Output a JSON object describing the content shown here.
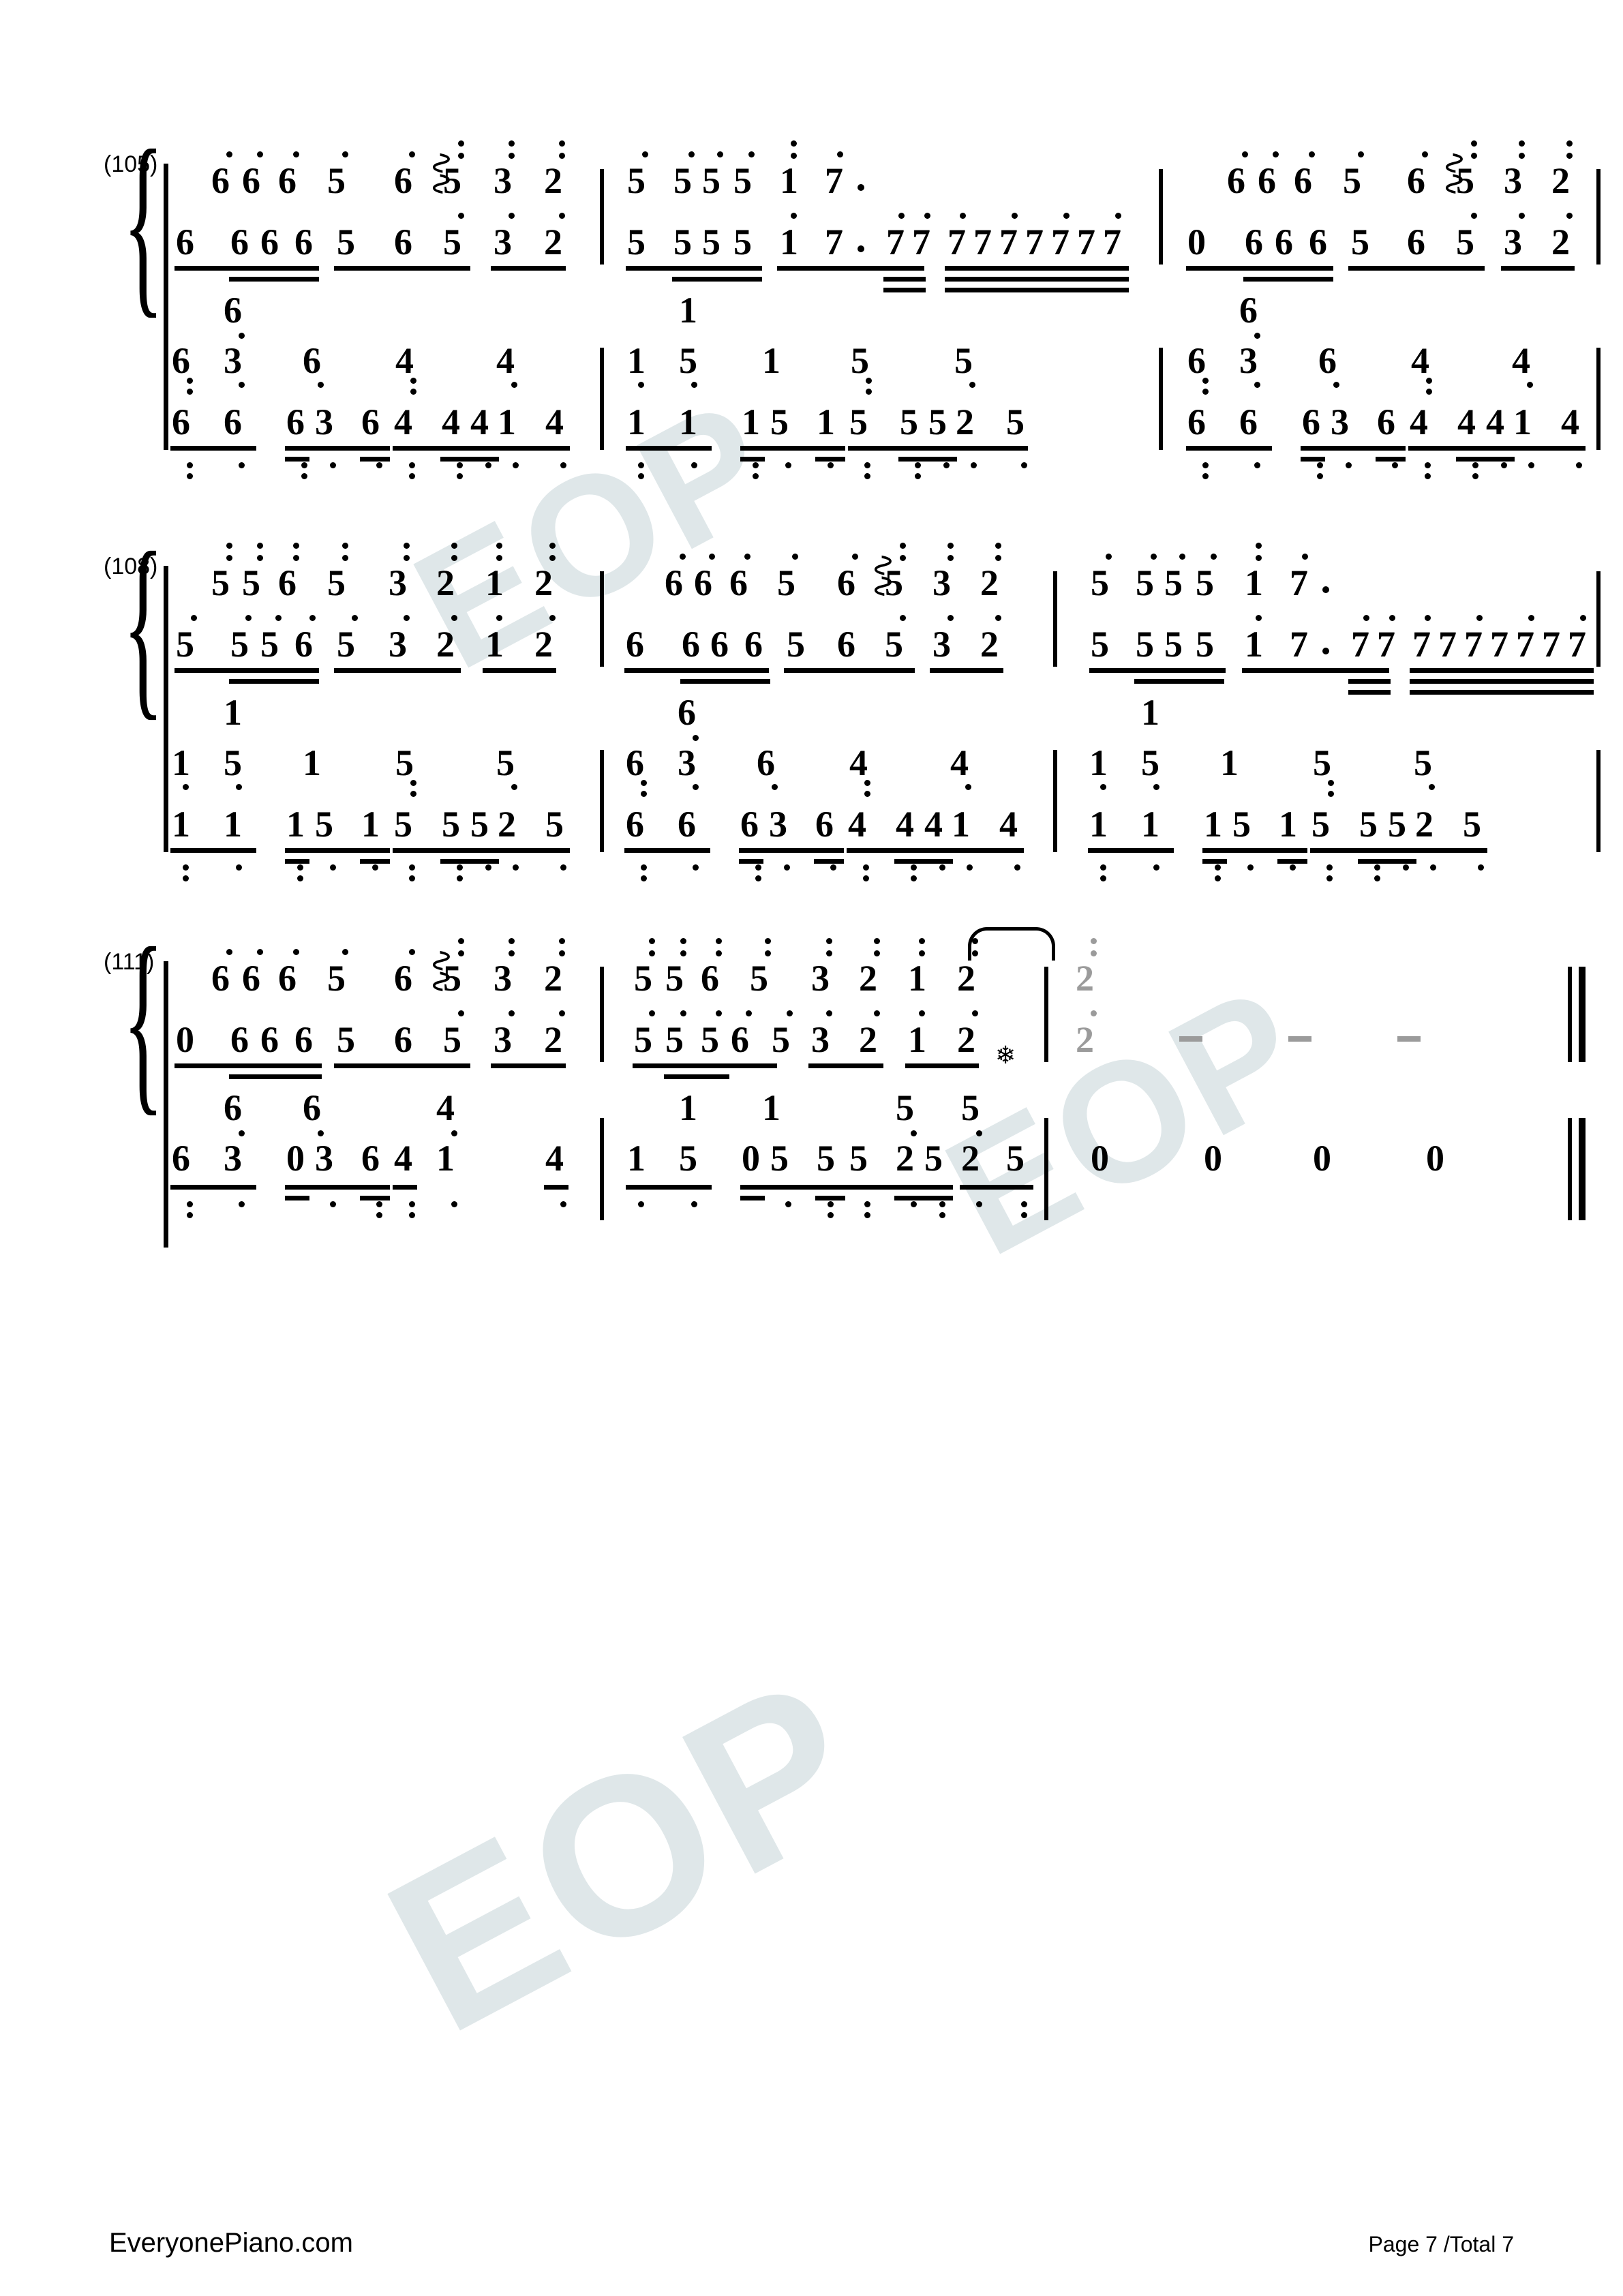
{
  "page": {
    "site": "EveryonePiano.com",
    "page_label": "Page 7 /Total 7",
    "watermark": "EOP",
    "watermark_color": "#dfe7e9",
    "ink_color": "#000000",
    "tie_color": "#9b9b9b",
    "notation_type": "jianpu-numbered-notation",
    "clefs": [
      "treble-right-hand",
      "bass-left-hand"
    ]
  },
  "systems": [
    {
      "measure_label": "(105)",
      "treble": {
        "measures": [
          {
            "cells": [
              {
                "t": "6",
                "up": 1,
                "beam": 1
              },
              {
                "t": "6",
                "up": 1,
                "beam": 2
              },
              {
                "t": "6",
                "up": 1,
                "beam": 1
              },
              {
                "t": "5",
                "up": 1,
                "beam": 1
              },
              {
                "t": "6",
                "up": 1,
                "beam": 1
              },
              {
                "t": "5",
                "up": 2,
                "beam": 1,
                "arp": true
              },
              {
                "t": "3",
                "up": 2,
                "beam": 1
              },
              {
                "t": "2",
                "up": 2,
                "beam": 1
              }
            ]
          },
          {
            "cells": [
              {
                "t": "5",
                "up": 1,
                "beam": 1
              },
              {
                "t": "5",
                "up": 1,
                "beam": 2
              },
              {
                "t": "5",
                "up": 1,
                "beam": 2
              },
              {
                "t": "5",
                "up": 1,
                "beam": 1
              },
              {
                "t": "1",
                "up": 2,
                "beam": 1
              },
              {
                "t": "7",
                "up": 1,
                "dot": true
              },
              {
                "t": "7",
                "up": 1,
                "beam": 2
              },
              {
                "t": "7",
                "up": 1,
                "beam": 2
              },
              {
                "t": "7",
                "up": 1,
                "beam": 3
              },
              {
                "t": "7",
                "up": 1,
                "beam": 3
              },
              {
                "t": "7",
                "up": 1,
                "beam": 3
              },
              {
                "t": "7",
                "up": 1,
                "beam": 3
              },
              {
                "t": "7",
                "up": 1,
                "beam": 3
              },
              {
                "t": "7",
                "up": 1,
                "beam": 3
              },
              {
                "t": "7",
                "up": 1,
                "beam": 3
              }
            ]
          },
          {
            "cells": [
              {
                "t": "0",
                "beam": 1
              },
              {
                "t": "6",
                "up": 1,
                "beam": 2
              },
              {
                "t": "6",
                "up": 1,
                "beam": 2
              },
              {
                "t": "6",
                "up": 1,
                "beam": 1
              },
              {
                "t": "5",
                "up": 1,
                "beam": 1
              },
              {
                "t": "6",
                "up": 1,
                "beam": 1
              },
              {
                "t": "5",
                "up": 2,
                "beam": 1,
                "arp": true
              },
              {
                "t": "3",
                "up": 2,
                "beam": 1
              },
              {
                "t": "2",
                "up": 2,
                "beam": 1
              }
            ]
          }
        ]
      },
      "bass": {
        "measures": [
          {
            "cells": [
              {
                "t": "6",
                "dn": 2,
                "top": "6",
                "topdn": 1
              },
              {
                "t": "6",
                "dn": 1,
                "beam": 1
              },
              {
                "t": "6",
                "dn": 1
              },
              {
                "t": "3",
                "beam": 1
              },
              {
                "t": "6",
                "dn": 1
              },
              {
                "t": "4",
                "dn": 2
              },
              {
                "t": "4",
                "beam": 1
              },
              {
                "t": "4",
                "beam": 1
              },
              {
                "t": "1",
                "dn": 1
              },
              {
                "t": "4",
                "beam": 1
              }
            ]
          },
          {
            "cells": [
              {
                "t": "1",
                "dn": 1,
                "top": "1"
              },
              {
                "t": "1",
                "dn": 1,
                "beam": 1
              },
              {
                "t": "1",
                "dn": 1
              },
              {
                "t": "5",
                "beam": 1
              },
              {
                "t": "1",
                "dn": 1
              },
              {
                "t": "5",
                "dn": 2
              },
              {
                "t": "5",
                "beam": 1
              },
              {
                "t": "5",
                "beam": 1
              },
              {
                "t": "2",
                "dn": 1
              },
              {
                "t": "5",
                "beam": 1
              }
            ]
          },
          {
            "cells": [
              {
                "t": "6",
                "dn": 2,
                "top": "6",
                "topdn": 1
              },
              {
                "t": "6",
                "dn": 1,
                "beam": 1
              },
              {
                "t": "6",
                "dn": 1
              },
              {
                "t": "3",
                "beam": 1
              },
              {
                "t": "6",
                "dn": 1
              },
              {
                "t": "4",
                "dn": 2
              },
              {
                "t": "4",
                "beam": 1
              },
              {
                "t": "4",
                "beam": 1
              },
              {
                "t": "1",
                "dn": 1
              },
              {
                "t": "4",
                "beam": 1
              }
            ]
          }
        ]
      }
    },
    {
      "measure_label": "(108)",
      "treble": {
        "measures": [
          {
            "cells": [
              {
                "t": "5",
                "up": 1
              },
              {
                "t": "5",
                "up": 2
              },
              {
                "t": "6",
                "up": 2
              },
              {
                "t": "5",
                "up": 2
              },
              {
                "t": "3",
                "up": 2
              },
              {
                "t": "2",
                "up": 2
              },
              {
                "t": "1",
                "up": 2
              },
              {
                "t": "2",
                "up": 2
              }
            ]
          },
          {
            "cells": [
              {
                "t": "6",
                "up": 1
              },
              {
                "t": "6",
                "up": 1
              },
              {
                "t": "6",
                "up": 1
              },
              {
                "t": "5",
                "up": 1
              },
              {
                "t": "6",
                "up": 1
              },
              {
                "t": "5",
                "up": 2
              },
              {
                "t": "3",
                "up": 2
              },
              {
                "t": "2",
                "up": 2
              }
            ]
          },
          {
            "cells": [
              {
                "t": "5",
                "up": 1
              },
              {
                "t": "5",
                "up": 1
              },
              {
                "t": "5",
                "up": 1
              },
              {
                "t": "5",
                "up": 1
              },
              {
                "t": "1",
                "up": 2
              },
              {
                "t": "7",
                "up": 1,
                "dot": true
              },
              {
                "t": "7",
                "up": 1
              },
              {
                "t": "7",
                "up": 1
              },
              {
                "t": "7",
                "up": 1
              },
              {
                "t": "7",
                "up": 1
              },
              {
                "t": "7",
                "up": 1
              },
              {
                "t": "7",
                "up": 1
              },
              {
                "t": "7",
                "up": 1
              },
              {
                "t": "7",
                "up": 1
              },
              {
                "t": "7",
                "up": 1
              }
            ]
          }
        ]
      },
      "bass": {
        "measures": [
          {
            "cells": [
              {
                "t": "1",
                "dn": 1,
                "top": "1"
              },
              {
                "t": "1",
                "dn": 1
              },
              {
                "t": "1",
                "dn": 1
              },
              {
                "t": "5"
              },
              {
                "t": "1",
                "dn": 1
              },
              {
                "t": "5",
                "dn": 2
              },
              {
                "t": "5"
              },
              {
                "t": "5"
              },
              {
                "t": "2",
                "dn": 1
              },
              {
                "t": "5"
              }
            ]
          },
          {
            "cells": [
              {
                "t": "6",
                "dn": 2,
                "top": "6",
                "topdn": 1
              },
              {
                "t": "6",
                "dn": 1
              },
              {
                "t": "6",
                "dn": 1
              },
              {
                "t": "3"
              },
              {
                "t": "6",
                "dn": 1
              },
              {
                "t": "4",
                "dn": 2
              },
              {
                "t": "4"
              },
              {
                "t": "4"
              },
              {
                "t": "1",
                "dn": 1
              },
              {
                "t": "4"
              }
            ]
          },
          {
            "cells": [
              {
                "t": "1",
                "dn": 1,
                "top": "1"
              },
              {
                "t": "1",
                "dn": 1
              },
              {
                "t": "1",
                "dn": 1
              },
              {
                "t": "5"
              },
              {
                "t": "1",
                "dn": 1
              },
              {
                "t": "5",
                "dn": 2
              },
              {
                "t": "5"
              },
              {
                "t": "5"
              },
              {
                "t": "2",
                "dn": 1
              },
              {
                "t": "5"
              }
            ]
          }
        ]
      }
    },
    {
      "measure_label": "(111)",
      "treble": {
        "measures": [
          {
            "cells": [
              {
                "t": "0"
              },
              {
                "t": "6",
                "up": 1
              },
              {
                "t": "6",
                "up": 1
              },
              {
                "t": "6",
                "up": 1
              },
              {
                "t": "5",
                "up": 1
              },
              {
                "t": "6",
                "up": 1
              },
              {
                "t": "5",
                "up": 2,
                "arp": true
              },
              {
                "t": "3",
                "up": 2
              },
              {
                "t": "2",
                "up": 2
              }
            ]
          },
          {
            "cells": [
              {
                "t": "5",
                "up": 1
              },
              {
                "t": "5",
                "up": 2
              },
              {
                "t": "6",
                "up": 2
              },
              {
                "t": "5",
                "up": 2
              },
              {
                "t": "3",
                "up": 2
              },
              {
                "t": "2",
                "up": 2
              },
              {
                "t": "1",
                "up": 2
              },
              {
                "t": "2",
                "up": 2
              }
            ]
          },
          {
            "cells": [
              {
                "t": "2",
                "up": 2,
                "tie": true
              },
              {
                "t": "-"
              },
              {
                "t": "-"
              },
              {
                "t": "-"
              }
            ]
          }
        ]
      },
      "bass": {
        "measures": [
          {
            "cells": [
              {
                "t": "6",
                "dn": 2,
                "top": "6"
              },
              {
                "t": "3",
                "dn": 1,
                "top2": "6"
              },
              {
                "t": "0"
              },
              {
                "t": "3",
                "dn": 1
              },
              {
                "t": "6",
                "dn": 1
              },
              {
                "t": "4",
                "dn": 2
              },
              {
                "t": "1",
                "dn": 1,
                "top3": "4"
              },
              {
                "t": "4",
                "dn": 1
              }
            ]
          },
          {
            "cells": [
              {
                "t": "1",
                "dn": 1,
                "top": "1"
              },
              {
                "t": "5",
                "dn": 1
              },
              {
                "t": "0"
              },
              {
                "t": "5",
                "dn": 1,
                "top": "1"
              },
              {
                "t": "5",
                "dn": 1
              },
              {
                "t": "5",
                "dn": 2
              },
              {
                "t": "2",
                "dn": 1,
                "top": "5"
              },
              {
                "t": "5",
                "dn": 2
              },
              {
                "t": "2",
                "dn": 1,
                "top": "5"
              },
              {
                "t": "5",
                "dn": 2
              }
            ]
          },
          {
            "cells": [
              {
                "t": "0"
              },
              {
                "t": "0"
              },
              {
                "t": "0"
              },
              {
                "t": "0"
              }
            ]
          }
        ]
      }
    }
  ]
}
